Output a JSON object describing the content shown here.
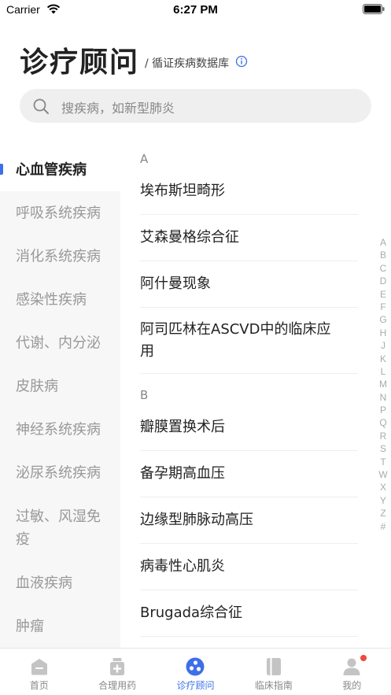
{
  "status_bar": {
    "carrier": "Carrier",
    "time": "6:27 PM"
  },
  "header": {
    "title": "诊疗顾问",
    "subtitle": "/ 循证疾病数据库"
  },
  "search": {
    "placeholder": "搜疾病，如新型肺炎"
  },
  "categories": [
    {
      "label": "心血管疾病",
      "active": true
    },
    {
      "label": "呼吸系统疾病",
      "active": false
    },
    {
      "label": "消化系统疾病",
      "active": false
    },
    {
      "label": "感染性疾病",
      "active": false
    },
    {
      "label": "代谢、内分泌",
      "active": false
    },
    {
      "label": "皮肤病",
      "active": false
    },
    {
      "label": "神经系统疾病",
      "active": false
    },
    {
      "label": "泌尿系统疾病",
      "active": false
    },
    {
      "label": "过敏、风湿免疫",
      "active": false
    },
    {
      "label": "血液疾病",
      "active": false
    },
    {
      "label": "肿瘤",
      "active": false
    }
  ],
  "disease_sections": [
    {
      "letter": "A",
      "items": [
        "埃布斯坦畸形",
        "艾森曼格综合征",
        "阿什曼现象",
        "阿司匹林在ASCVD中的临床应用"
      ]
    },
    {
      "letter": "B",
      "items": [
        "瓣膜置换术后",
        "备孕期高血压",
        "边缘型肺脉动高压",
        "病毒性心肌炎",
        "Brugada综合征"
      ]
    }
  ],
  "alphabet_index": [
    "A",
    "B",
    "C",
    "D",
    "E",
    "F",
    "G",
    "H",
    "J",
    "K",
    "L",
    "M",
    "N",
    "P",
    "Q",
    "R",
    "S",
    "T",
    "W",
    "X",
    "Y",
    "Z",
    "#"
  ],
  "tabs": [
    {
      "label": "首页",
      "icon": "home-icon",
      "active": false
    },
    {
      "label": "合理用药",
      "icon": "medicine-icon",
      "active": false
    },
    {
      "label": "诊疗顾问",
      "icon": "advisor-icon",
      "active": true
    },
    {
      "label": "临床指南",
      "icon": "book-icon",
      "active": false
    },
    {
      "label": "我的",
      "icon": "profile-icon",
      "active": false
    }
  ],
  "colors": {
    "accent": "#3d6fe8",
    "badge": "#f04a3a",
    "sidebar_bg": "#f7f7f7",
    "search_bg": "#efefef"
  }
}
